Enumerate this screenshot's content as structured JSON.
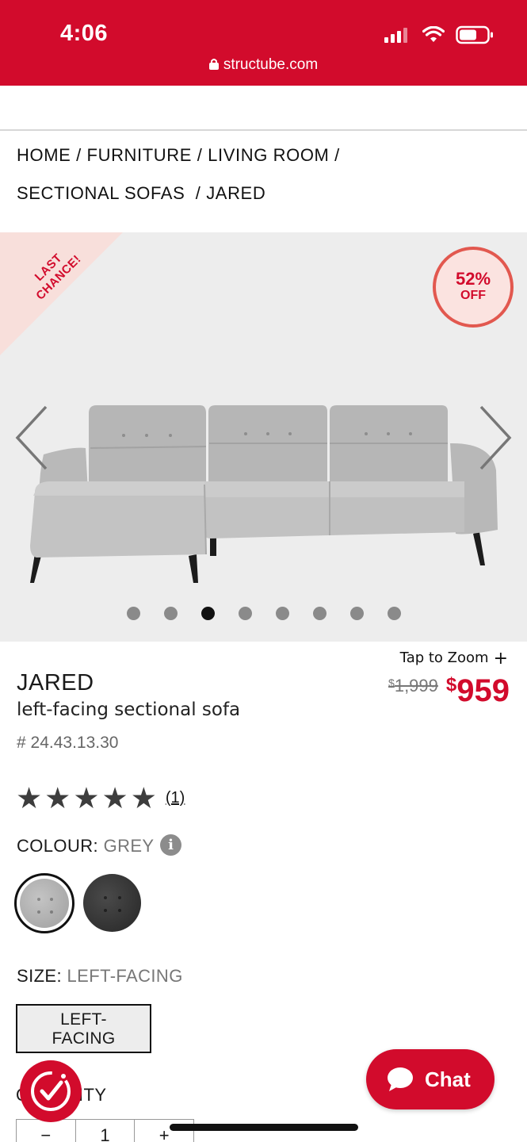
{
  "status_bar": {
    "time": "4:06",
    "url": "structube.com"
  },
  "breadcrumb": {
    "line1": "HOME / FURNITURE / LIVING ROOM /",
    "line2": "SECTIONAL SOFAS  / JARED"
  },
  "gallery": {
    "ribbon": "LAST CHANCE!",
    "discount_pct": "52%",
    "discount_off": "OFF",
    "dot_count": 8,
    "active_index": 2
  },
  "product": {
    "name": "JARED",
    "subtitle": "left-facing sectional sofa",
    "sku": "# 24.43.13.30",
    "zoom_label": "Tap to Zoom",
    "old_currency": "$",
    "old_price": "1,999",
    "new_currency": "$",
    "new_price": "959",
    "rating": 5,
    "review_count": "(1)"
  },
  "colour": {
    "label": "COLOUR:",
    "value": "GREY",
    "selected": "grey"
  },
  "size": {
    "label": "SIZE:",
    "value": "LEFT-FACING",
    "button": "LEFT-\nFACING"
  },
  "quantity": {
    "label": "QUANTITY",
    "value": "1"
  },
  "chat": {
    "label": "Chat"
  },
  "colors": {
    "brand": "#d20b2c",
    "discount_ring": "#e2584f"
  }
}
